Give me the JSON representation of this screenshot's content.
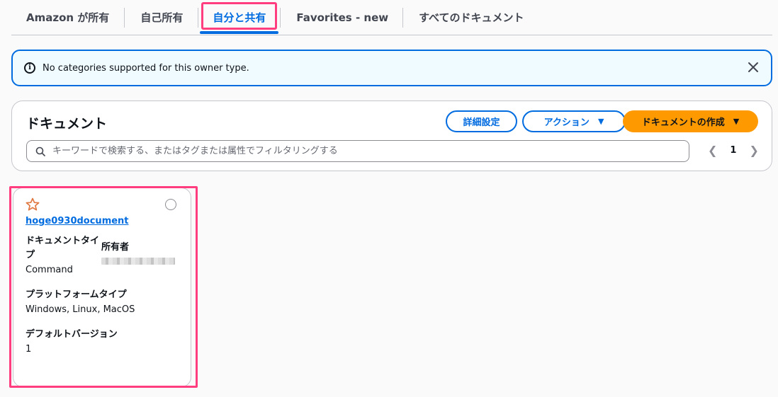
{
  "tabs": [
    {
      "label": "Amazon が所有"
    },
    {
      "label": "自己所有"
    },
    {
      "label": "自分と共有",
      "selected": true
    },
    {
      "label": "Favorites - new"
    },
    {
      "label": "すべてのドキュメント"
    }
  ],
  "flash": {
    "message": "No categories supported for this owner type.",
    "icon": "info-icon"
  },
  "documents": {
    "title": "ドキュメント",
    "details_button": "詳細設定",
    "actions_button": "アクション",
    "create_button": "ドキュメントの作成",
    "search_placeholder": "キーワードで検索する、またはタグまたは属性でフィルタリングする",
    "page_number": "1"
  },
  "card": {
    "name": "hoge0930document",
    "doc_type_label": "ドキュメントタイプ",
    "doc_type_value": "Command",
    "owner_label": "所有者",
    "platform_label": "プラットフォームタイプ",
    "platform_value": "Windows, Linux, MacOS",
    "version_label": "デフォルトバージョン",
    "version_value": "1"
  },
  "colors": {
    "accent": "#006ce0",
    "primary_button": "#ff9900",
    "highlight": "#ff3d7f",
    "star": "#e07941",
    "flash_bg": "#f0fbff"
  }
}
